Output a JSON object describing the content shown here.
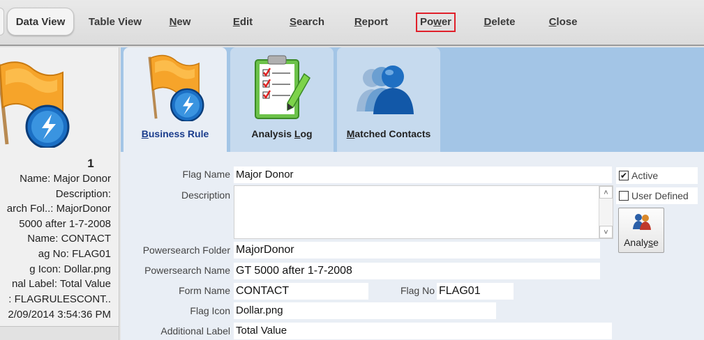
{
  "toolbar": {
    "items": [
      {
        "label": "Data View"
      },
      {
        "label": "Table View"
      },
      {
        "label": "New",
        "accel": "N",
        "rest": "ew"
      },
      {
        "label": "Edit",
        "accel": "E",
        "rest": "dit"
      },
      {
        "label": "Search",
        "accel": "S",
        "rest": "earch"
      },
      {
        "label": "Report",
        "accel": "R",
        "rest": "eport"
      },
      {
        "label": "Power",
        "pre": "Po",
        "accel": "w",
        "rest": "er"
      },
      {
        "label": "Delete",
        "accel": "D",
        "rest": "elete"
      },
      {
        "label": "Close",
        "accel": "C",
        "rest": "lose"
      }
    ]
  },
  "summary": {
    "record_number": "1",
    "lines": [
      "Name: Major Donor",
      "Description:",
      "arch Fol..: MajorDonor",
      "5000 after 1-7-2008",
      "Name: CONTACT",
      "ag No: FLAG01",
      "g Icon: Dollar.png",
      "nal Label: Total Value",
      ": FLAGRULESCONT..",
      "2/09/2014 3:54:36 PM"
    ]
  },
  "tabs": [
    {
      "pre": "",
      "accel": "B",
      "rest": "usiness Rule",
      "icon": "flag-rule-icon"
    },
    {
      "pre": "Analysis ",
      "accel": "L",
      "rest": "og",
      "icon": "clipboard-checklist-icon"
    },
    {
      "pre": "",
      "accel": "M",
      "rest": "atched Contacts",
      "icon": "people-group-icon"
    }
  ],
  "form": {
    "flag_name_label": "Flag Name",
    "flag_name": "Major Donor",
    "description_label": "Description",
    "description": "",
    "powersearch_folder_label": "Powersearch Folder",
    "powersearch_folder": "MajorDonor",
    "powersearch_name_label": "Powersearch Name",
    "powersearch_name": "GT 5000 after 1-7-2008",
    "form_name_label": "Form Name",
    "form_name": "CONTACT",
    "flag_no_label": "Flag No",
    "flag_no": "FLAG01",
    "flag_icon_label": "Flag Icon",
    "flag_icon": "Dollar.png",
    "additional_label_label": "Additional Label",
    "additional_label": "Total Value",
    "active_label": "Active",
    "active_checked": true,
    "user_defined_label": "User Defined",
    "user_defined_checked": false,
    "analyse_pre": "Analy",
    "analyse_accel": "s",
    "analyse_rest": "e"
  },
  "colors": {
    "tab_strip": "#a3c5e6",
    "selected_tab_text": "#1a3c8c",
    "power_highlight": "#e0202a"
  }
}
